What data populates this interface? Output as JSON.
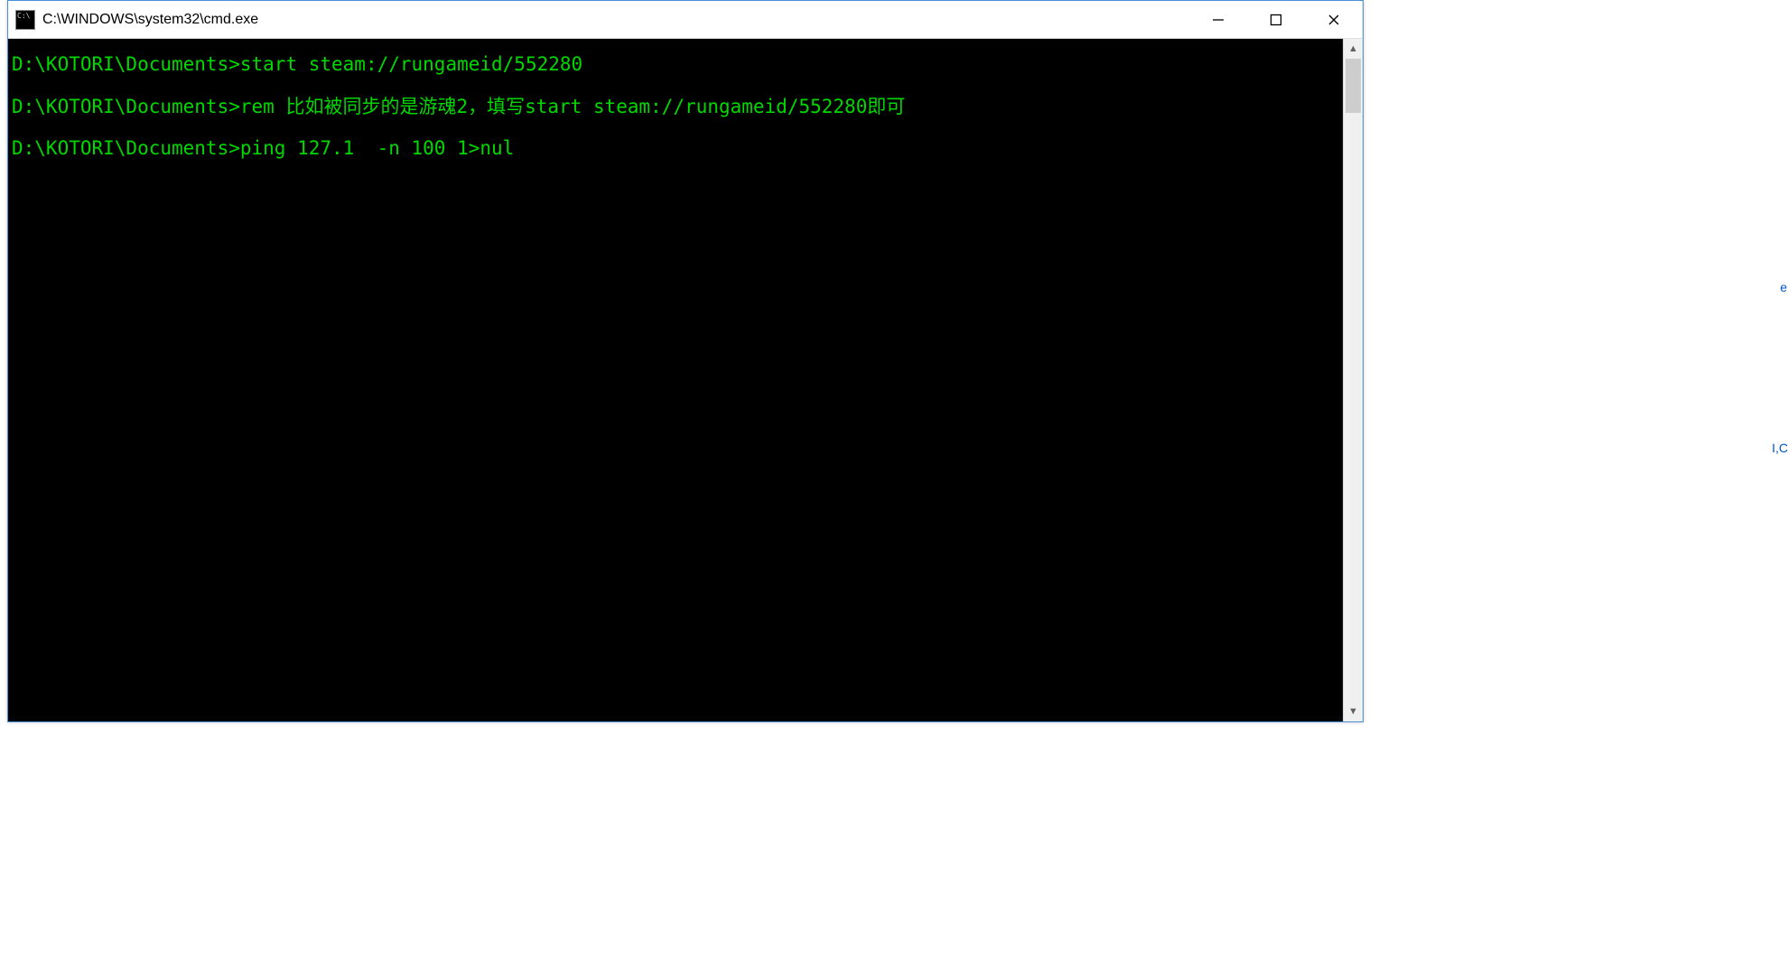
{
  "window": {
    "title": "C:\\WINDOWS\\system32\\cmd.exe"
  },
  "terminal": {
    "prompt": "D:\\KOTORI\\Documents>",
    "lines": [
      {
        "prompt": "D:\\KOTORI\\Documents>",
        "cmd": "start steam://rungameid/552280"
      },
      {
        "prompt": "D:\\KOTORI\\Documents>",
        "cmd": "rem 比如被同步的是游魂2，填写start steam://rungameid/552280即可"
      },
      {
        "prompt": "D:\\KOTORI\\Documents>",
        "cmd": "ping 127.1  -n 100 1>nul"
      }
    ]
  },
  "bg": {
    "c1": "e",
    "c2": "I,C",
    "c3": " "
  }
}
